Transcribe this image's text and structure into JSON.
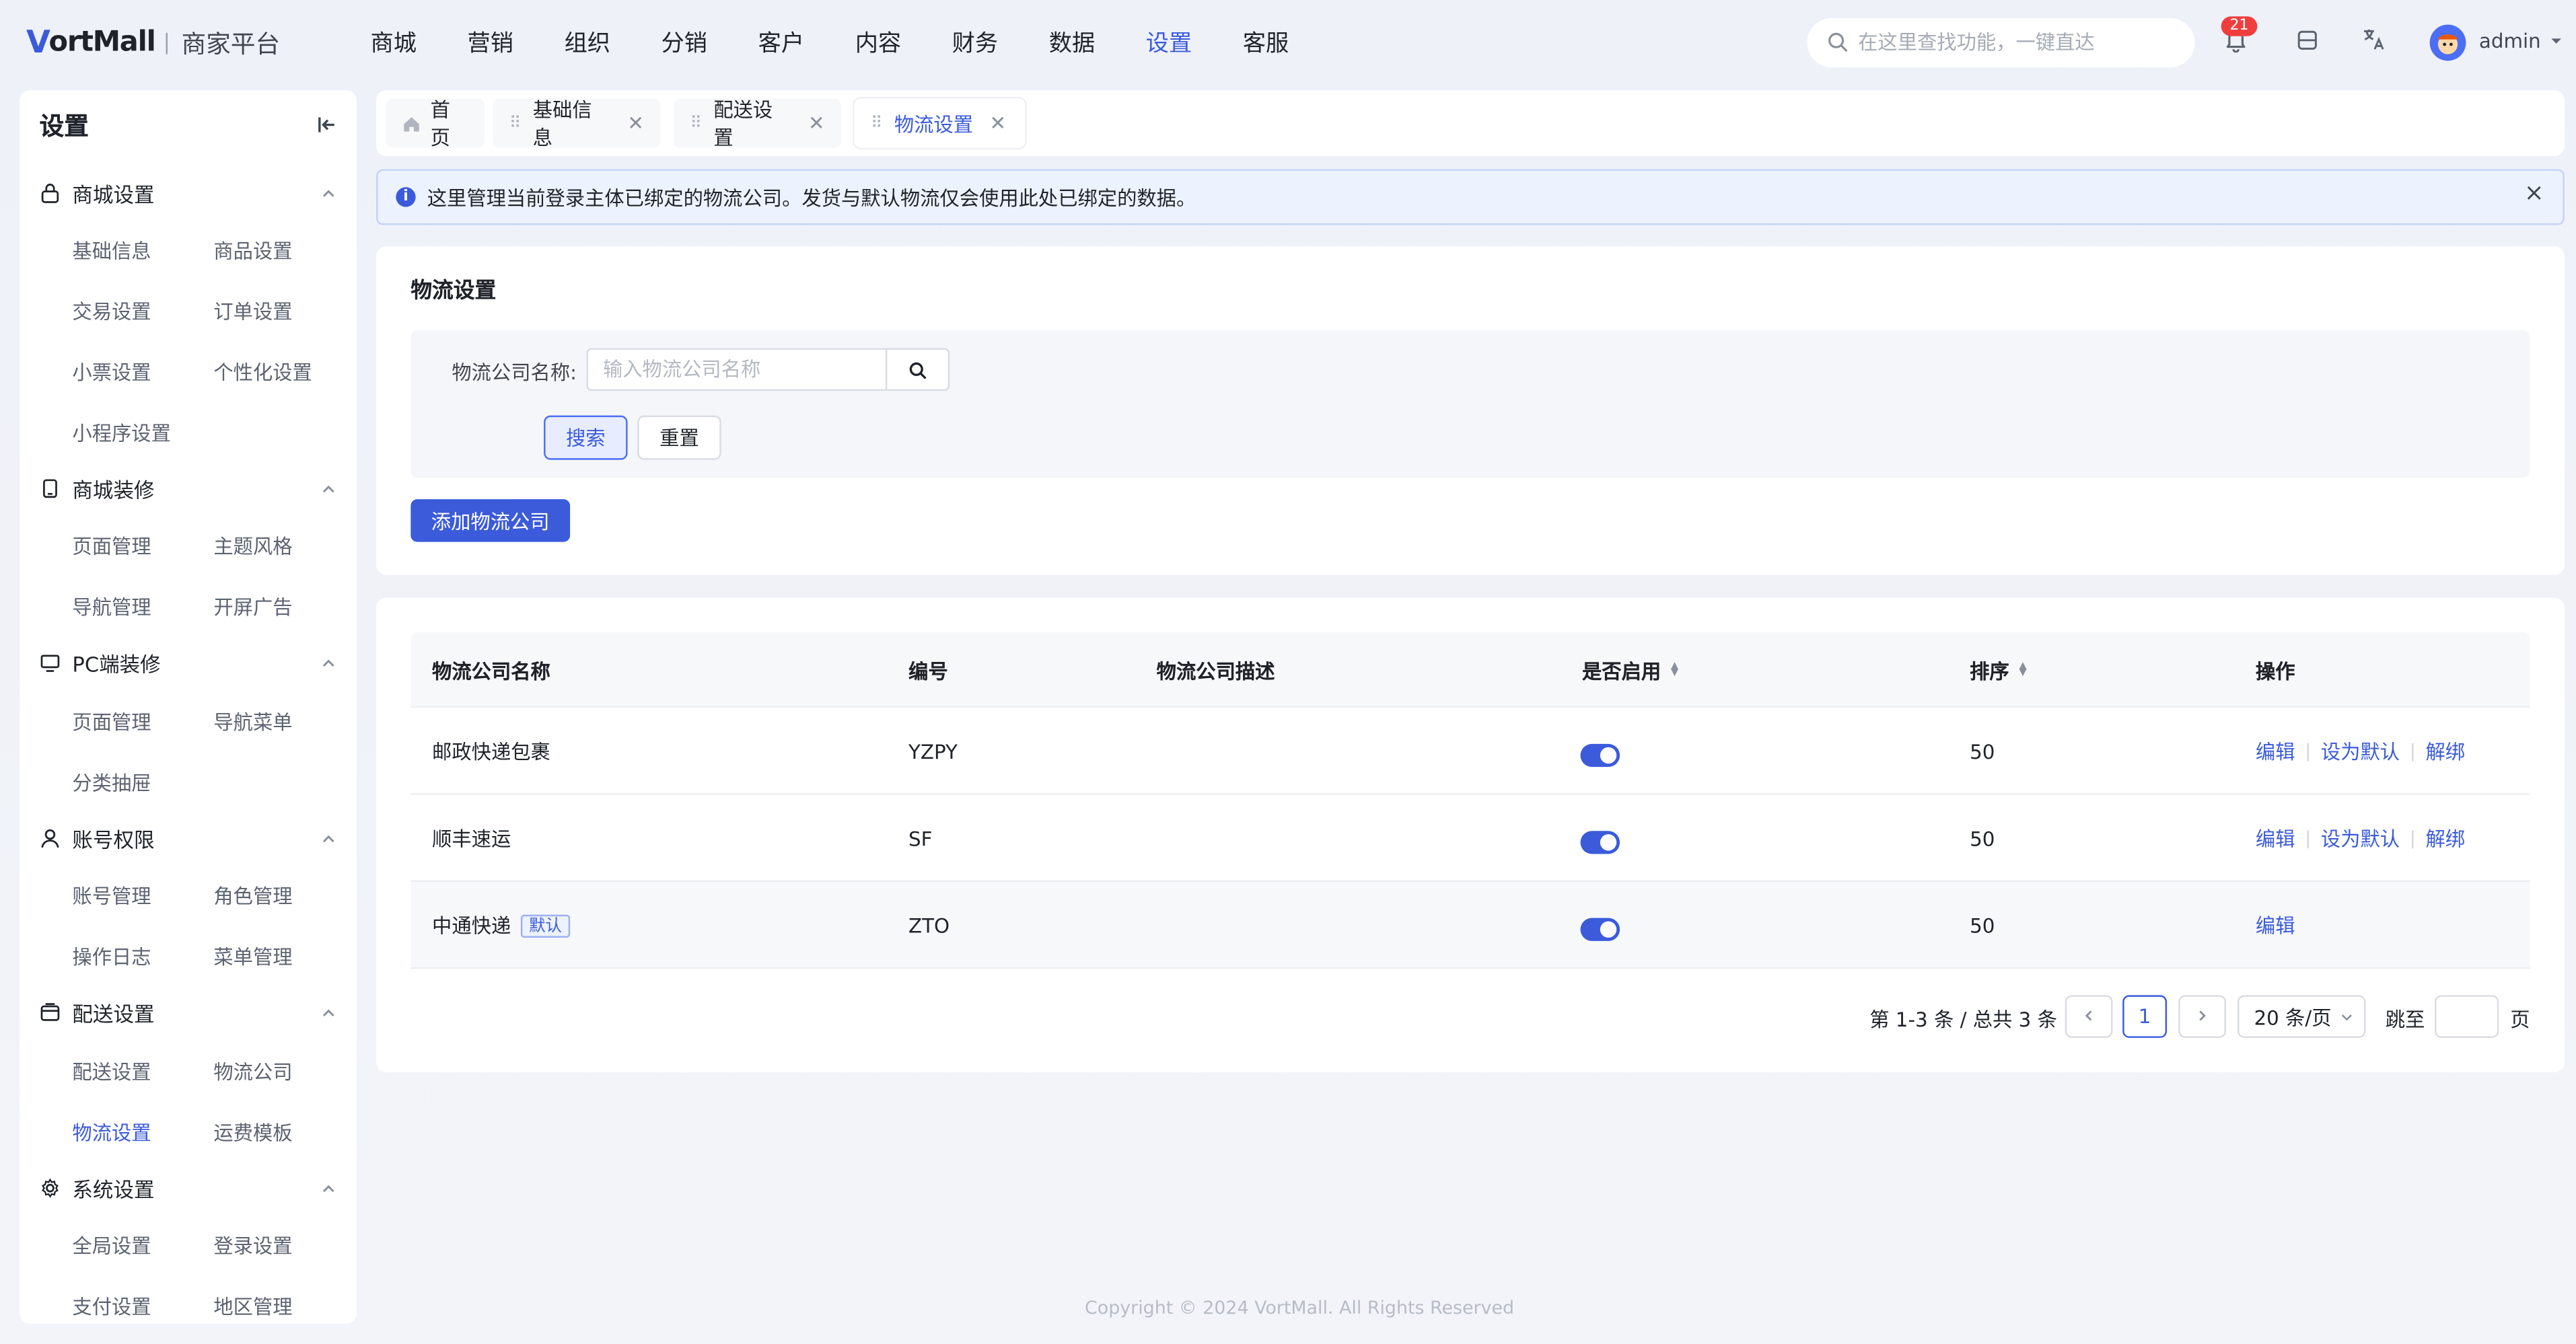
{
  "brand": {
    "logo_mark": "V",
    "logo_text": "ortMall",
    "platform": "商家平台"
  },
  "topnav": [
    {
      "label": "商城",
      "active": false
    },
    {
      "label": "营销",
      "active": false
    },
    {
      "label": "组织",
      "active": false
    },
    {
      "label": "分销",
      "active": false
    },
    {
      "label": "客户",
      "active": false
    },
    {
      "label": "内容",
      "active": false
    },
    {
      "label": "财务",
      "active": false
    },
    {
      "label": "数据",
      "active": false
    },
    {
      "label": "设置",
      "active": true
    },
    {
      "label": "客服",
      "active": false
    }
  ],
  "header": {
    "search_placeholder": "在这里查找功能，一键直达",
    "notification_count": "21",
    "user": "admin"
  },
  "sidebar": {
    "title": "设置",
    "groups": [
      {
        "label": "商城设置",
        "icon": "store-lock-icon",
        "items": [
          "基础信息",
          "商品设置",
          "交易设置",
          "订单设置",
          "小票设置",
          "个性化设置",
          "小程序设置"
        ]
      },
      {
        "label": "商城装修",
        "icon": "mobile-icon",
        "items": [
          "页面管理",
          "主题风格",
          "导航管理",
          "开屏广告"
        ]
      },
      {
        "label": "PC端装修",
        "icon": "monitor-icon",
        "items": [
          "页面管理",
          "导航菜单",
          "分类抽屉"
        ]
      },
      {
        "label": "账号权限",
        "icon": "user-icon",
        "items": [
          "账号管理",
          "角色管理",
          "操作日志",
          "菜单管理"
        ]
      },
      {
        "label": "配送设置",
        "icon": "delivery-icon",
        "items": [
          "配送设置",
          "物流公司",
          "物流设置",
          "运费模板"
        ]
      },
      {
        "label": "系统设置",
        "icon": "gear-icon",
        "items": [
          "全局设置",
          "登录设置",
          "支付设置",
          "地区管理"
        ]
      }
    ],
    "active_item": "物流设置"
  },
  "tabs": [
    {
      "label": "首页",
      "closable": false,
      "active": false
    },
    {
      "label": "基础信息",
      "closable": true,
      "active": false
    },
    {
      "label": "配送设置",
      "closable": true,
      "active": false
    },
    {
      "label": "物流设置",
      "closable": true,
      "active": true
    }
  ],
  "alert": {
    "text": "这里管理当前登录主体已绑定的物流公司。发货与默认物流仅会使用此处已绑定的数据。"
  },
  "filter": {
    "title": "物流设置",
    "label": "物流公司名称:",
    "placeholder": "输入物流公司名称",
    "search_label": "搜索",
    "reset_label": "重置",
    "add_label": "添加物流公司"
  },
  "table": {
    "columns": [
      "物流公司名称",
      "编号",
      "物流公司描述",
      "是否启用",
      "排序",
      "操作"
    ],
    "rows": [
      {
        "name": "邮政快递包裹",
        "code": "YZPY",
        "desc": "",
        "enabled": true,
        "sort": "50",
        "is_default": false,
        "actions": [
          "编辑",
          "设为默认",
          "解绑"
        ]
      },
      {
        "name": "顺丰速运",
        "code": "SF",
        "desc": "",
        "enabled": true,
        "sort": "50",
        "is_default": false,
        "actions": [
          "编辑",
          "设为默认",
          "解绑"
        ]
      },
      {
        "name": "中通快递",
        "code": "ZTO",
        "desc": "",
        "enabled": true,
        "sort": "50",
        "is_default": true,
        "default_tag": "默认",
        "actions": [
          "编辑"
        ]
      }
    ]
  },
  "pagination": {
    "total_text": "第 1-3 条 / 总共 3 条",
    "current_page": "1",
    "page_size": "20 条/页",
    "jump_label": "跳至",
    "page_label": "页"
  },
  "footer": {
    "copyright": "Copyright © 2024 VortMall. All Rights Reserved"
  },
  "colors": {
    "primary": "#3b5bdb",
    "badge": "#f03e3e",
    "alert_bg": "#edf2ff"
  }
}
